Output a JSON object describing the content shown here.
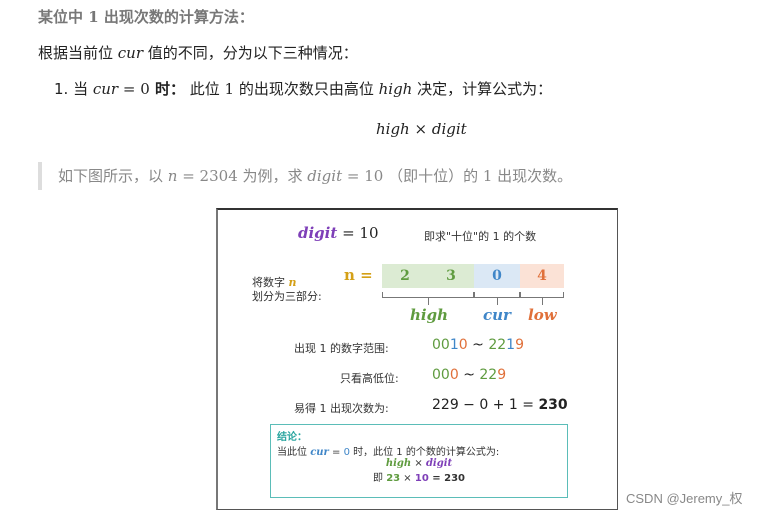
{
  "heading": {
    "prefix": "某位中 ",
    "one": "1",
    "suffix": " 出现次数的计算方法："
  },
  "intro": {
    "prefix": "根据当前位 ",
    "var": "cur",
    "suffix": " 值的不同，分为以下三种情况："
  },
  "case1": {
    "number": "1. 当 ",
    "cond_var": "cur",
    "cond_rest": " = 0",
    "when": " 时：",
    "text_a": " 此位 ",
    "one": "1",
    "text_b": " 的出现次数只由高位 ",
    "high": "high",
    "text_c": " 决定，计算公式为："
  },
  "formula": {
    "left": "high",
    "op": " × ",
    "right": "digit"
  },
  "quote": {
    "a": "如下图所示，以 ",
    "n": "n",
    "b": " = 2304",
    "c": " 为例，求 ",
    "digit": "digit",
    "d": " = 10",
    "e": " （即十位）的 ",
    "one": "1",
    "f": " 出现次数。"
  },
  "figure": {
    "digit_label": "digit",
    "digit_value": " = 10",
    "hint": "即求\"十位\"的  1  的个数",
    "split_label_line1_a": "将数字 ",
    "split_label_line1_n": "n",
    "split_label_line2": "划分为三部分:",
    "n_eq": "n  =",
    "digits": [
      "2",
      "3",
      "0",
      "4"
    ],
    "parts": {
      "high": "high",
      "cur": "cur",
      "low": "low"
    },
    "range_label": "出现  1  的数字范围:",
    "range": {
      "a_high": "00",
      "a_cur": "1",
      "a_low": "0",
      "sep": " ~ ",
      "b_high": "22",
      "b_cur": "1",
      "b_low": "9"
    },
    "hl_label": "只看高低位:",
    "hl": {
      "a_high": "00",
      "a_low": "0",
      "sep": " ~ ",
      "b_high": "22",
      "b_low": "9"
    },
    "count_label": "易得  1  出现次数为:",
    "count_expr": "229 − 0 + 1 = ",
    "count_result": "230",
    "conclusion": {
      "title": "结论：",
      "line1_a": "当此位  ",
      "line1_cur": "cur",
      "line1_eq": " = ",
      "line1_zero": "0",
      "line1_b": "  时，此位  1  的个数的计算公式为:",
      "line2_high": "high",
      "line2_op": " × ",
      "line2_digit": "digit",
      "line3_prefix": "即 ",
      "line3_23": "23",
      "line3_op": " × ",
      "line3_10": "10",
      "line3_eq": " = 230"
    }
  },
  "watermark": "CSDN @Jeremy_权",
  "colors": {
    "high": "#5f9b3f",
    "cur": "#3f86c8",
    "low": "#e0703a",
    "digit": "#7e3fb8",
    "high_bg": "#dcebd3",
    "cur_bg": "#dbe8f5",
    "low_bg": "#fbe2d6",
    "conclusion_border": "#5bbdb8"
  }
}
